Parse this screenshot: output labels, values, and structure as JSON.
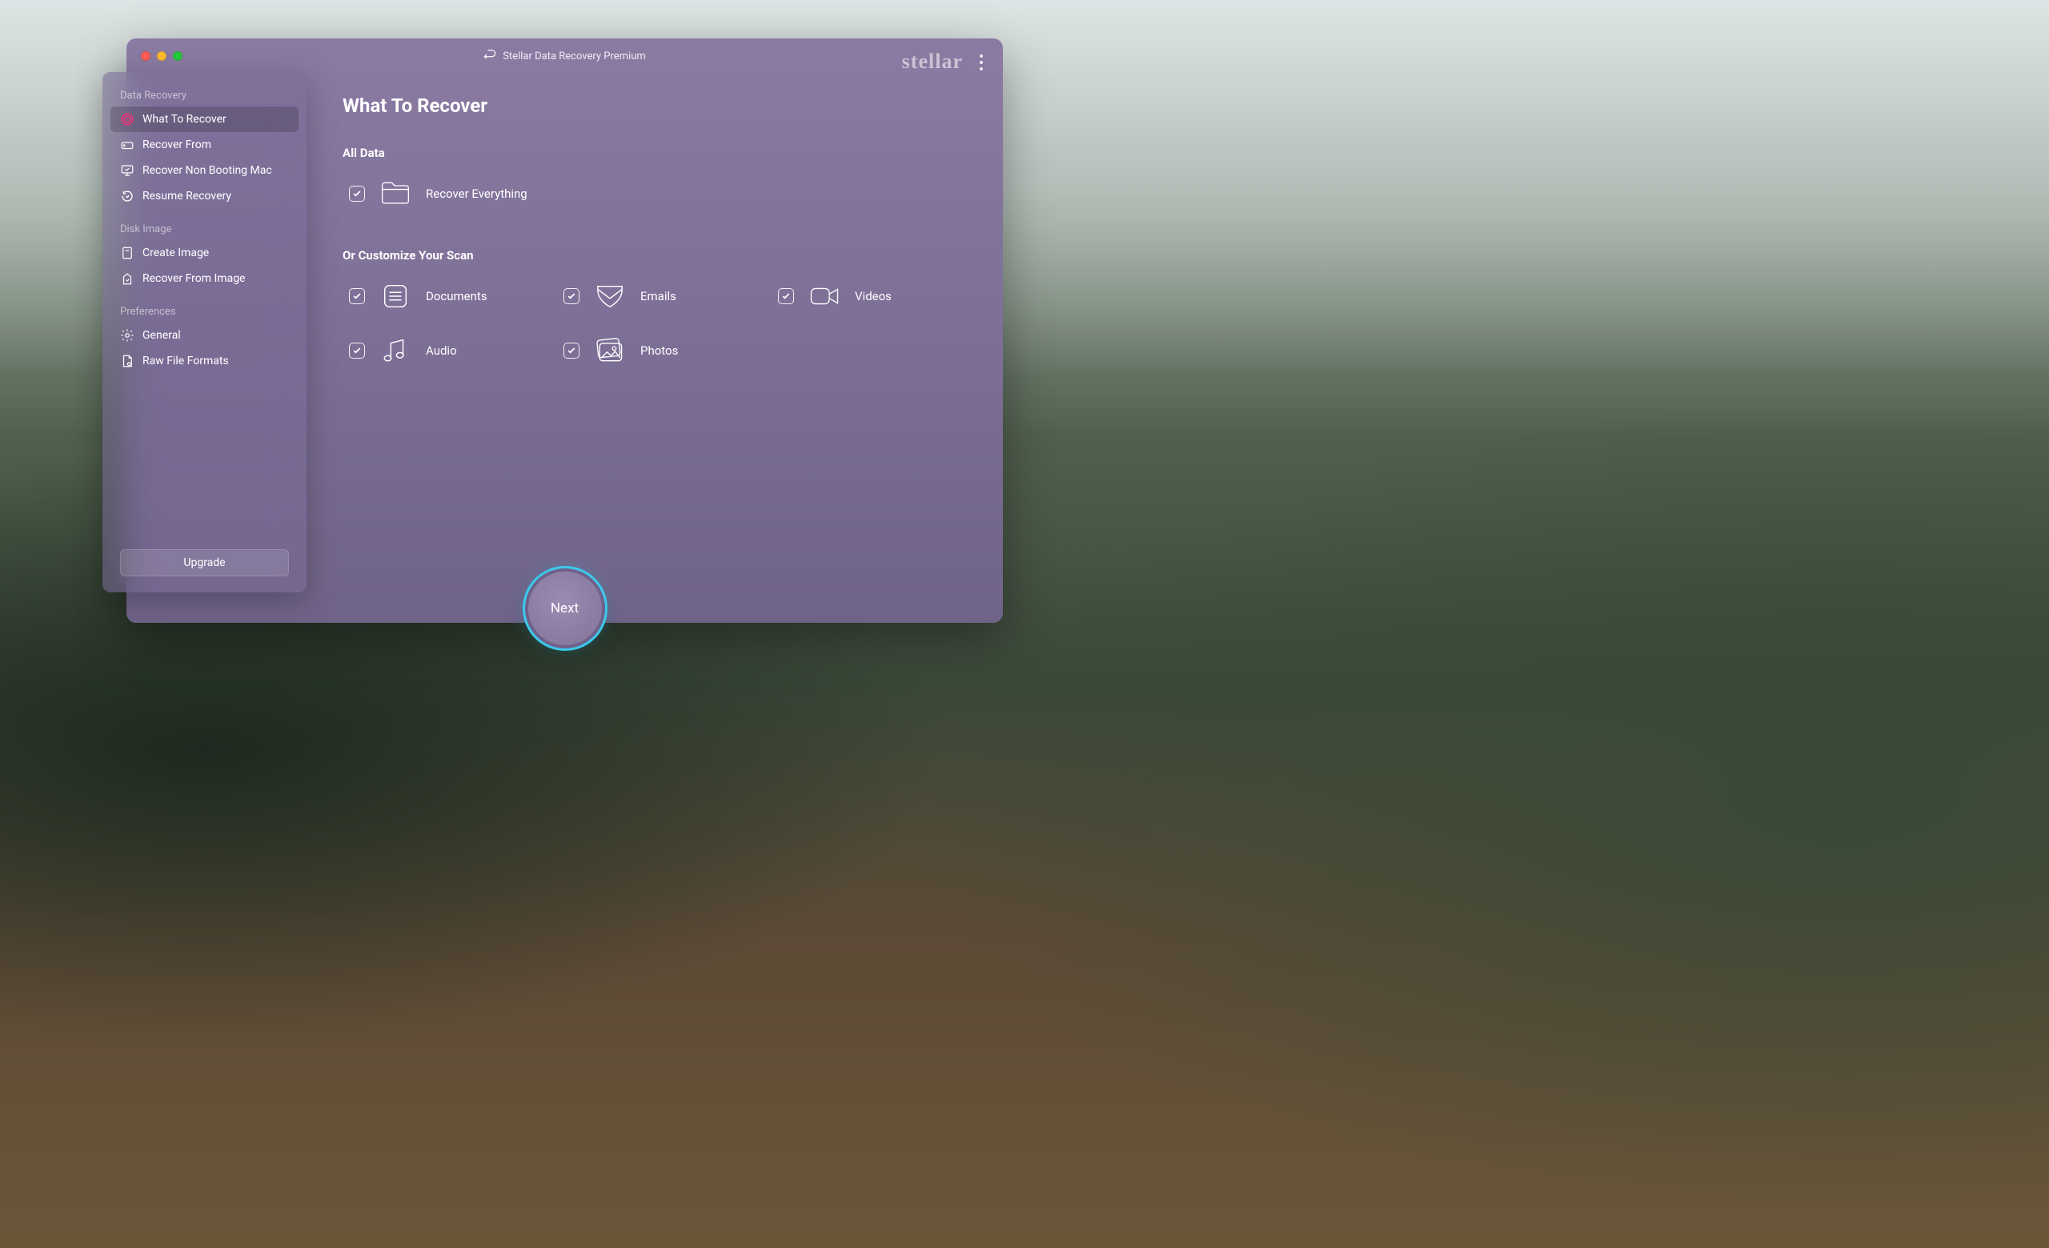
{
  "titlebar": {
    "title": "Stellar Data Recovery Premium",
    "brand": "stellar"
  },
  "sidebar": {
    "groups": [
      {
        "label": "Data Recovery",
        "items": [
          {
            "label": "What To Recover",
            "active": true,
            "icon": "target"
          },
          {
            "label": "Recover From",
            "icon": "drive"
          },
          {
            "label": "Recover Non Booting Mac",
            "icon": "monitor"
          },
          {
            "label": "Resume Recovery",
            "icon": "resume"
          }
        ]
      },
      {
        "label": "Disk Image",
        "items": [
          {
            "label": "Create Image",
            "icon": "create-image"
          },
          {
            "label": "Recover From Image",
            "icon": "recover-image"
          }
        ]
      },
      {
        "label": "Preferences",
        "items": [
          {
            "label": "General",
            "icon": "gear"
          },
          {
            "label": "Raw File Formats",
            "icon": "raw"
          }
        ]
      }
    ],
    "upgrade": "Upgrade"
  },
  "main": {
    "title": "What To Recover",
    "section_all": "All Data",
    "section_custom": "Or Customize Your Scan",
    "options_all": [
      {
        "label": "Recover Everything",
        "icon": "folder",
        "checked": true
      }
    ],
    "options_custom": [
      {
        "label": "Documents",
        "icon": "documents",
        "checked": true
      },
      {
        "label": "Emails",
        "icon": "emails",
        "checked": true
      },
      {
        "label": "Videos",
        "icon": "videos",
        "checked": true
      },
      {
        "label": "Audio",
        "icon": "audio",
        "checked": true
      },
      {
        "label": "Photos",
        "icon": "photos",
        "checked": true
      }
    ],
    "next": "Next"
  }
}
